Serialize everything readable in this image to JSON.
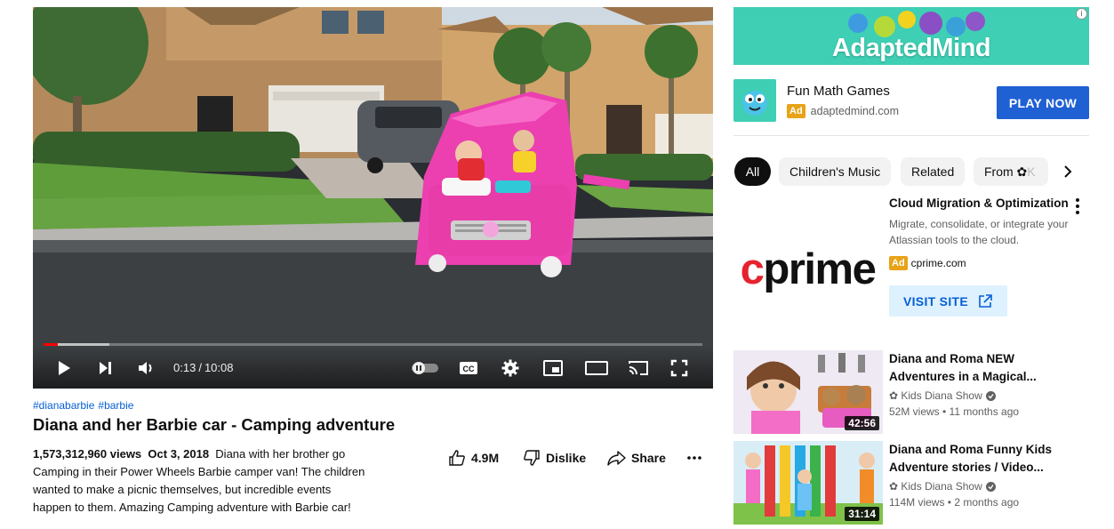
{
  "video": {
    "time_current": "0:13",
    "time_sep": "/",
    "time_total": "10:08",
    "progress_played": 0.021,
    "progress_buffered": 0.1,
    "hashtags": [
      "#dianabarbie",
      "#barbie"
    ],
    "title": "Diana and her Barbie car - Camping adventure",
    "views": "1,573,312,960 views",
    "date": "Oct 3, 2018",
    "description": "Diana with her brother go Camping in their Power Wheels Barbie camper van! The children wanted to make a picnic themselves, but incredible events happen to them. Amazing Camping adventure with Barbie car!"
  },
  "actions": {
    "like_count": "4.9M",
    "dislike_label": "Dislike",
    "share_label": "Share"
  },
  "ad1": {
    "banner_text": "AdaptedMind",
    "info": "i",
    "title": "Fun Math Games",
    "badge": "Ad",
    "domain": "adaptedmind.com",
    "cta": "PLAY NOW"
  },
  "chips": [
    {
      "label": "All"
    },
    {
      "label": "Children's Music"
    },
    {
      "label": "Related"
    },
    {
      "label": "From ✿ K"
    }
  ],
  "ad2": {
    "logo_c": "c",
    "logo_rest": "prime",
    "title": "Cloud Migration & Optimization",
    "description": "Migrate, consolidate, or integrate your Atlassian tools to the cloud.",
    "badge": "Ad",
    "domain": "cprime.com",
    "cta": "VISIT SITE"
  },
  "recommendations": [
    {
      "title": "Diana and Roma NEW Adventures in a Magical...",
      "channel": "✿ Kids Diana Show",
      "meta": "52M views • 11 months ago",
      "duration": "42:56"
    },
    {
      "title": "Diana and Roma Funny Kids Adventure stories / Video...",
      "channel": "✿ Kids Diana Show",
      "meta": "114M views • 2 months ago",
      "duration": "31:14"
    }
  ],
  "colors": {
    "accent_red": "#ff0000",
    "cta_blue": "#1f60d3",
    "ad_badge": "#e8a318",
    "brand_teal": "#3ecfb4"
  }
}
